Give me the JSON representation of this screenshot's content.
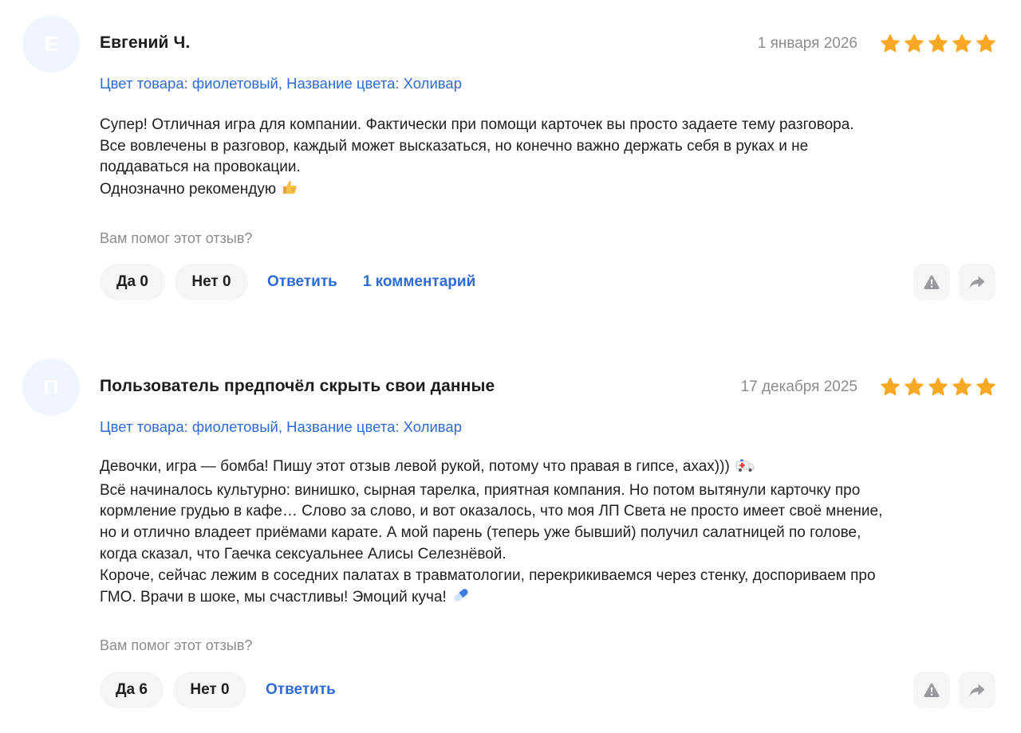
{
  "colors": {
    "star": "#f9a825",
    "link": "#2f6bd6",
    "muted": "#8c8c8c",
    "pill_bg": "#f5f5f7",
    "avatar_bg": "#f0f5fd"
  },
  "reviews": [
    {
      "avatar_letter": "Е",
      "author": "Евгений Ч.",
      "date": "1 января 2026",
      "rating": 5,
      "variant": "Цвет товара: фиолетовый, Название цвета: Холивар",
      "text_lines": [
        "Супер! Отличная игра для компании. Фактически при помощи карточек вы просто задаете тему разговора.",
        "Все вовлечены в разговор, каждый может высказаться, но конечно важно держать себя в руках и не",
        "поддаваться на провокации.",
        "Однозначно рекомендую"
      ],
      "emoji_icon": "thumbs-up-emoji",
      "helpful_question": "Вам помог этот отзыв?",
      "yes_label": "Да 0",
      "no_label": "Нет 0",
      "reply_label": "Ответить",
      "comments_label": "1 комментарий",
      "report_icon": "warning-icon",
      "share_icon": "share-icon"
    },
    {
      "avatar_letter": "П",
      "author": "Пользователь предпочёл скрыть свои данные",
      "date": "17 декабря 2025",
      "rating": 5,
      "variant": "Цвет товара: фиолетовый, Название цвета: Холивар",
      "text_lines": [
        "Девочки, игра — бомба! Пишу этот отзыв левой рукой, потому что правая в гипсе, ахах)))",
        "Всё начиналось культурно: винишко, сырная тарелка, приятная компания. Но потом вытянули карточку про",
        "кормление грудью в кафе… Слово за слово, и вот оказалось, что моя ЛП Света не просто имеет своё мнение,",
        "но и отлично владеет приёмами карате. А мой парень (теперь уже бывший) получил салатницей по голове,",
        "когда сказал, что Гаечка сексуальнее Алисы Селезнёвой.",
        "Короче, сейчас лежим в соседних палатах в травматологии, перекрикиваемся через стенку, доспориваем про",
        "ГМО. Врачи в шоке, мы счастливы! Эмоций куча!"
      ],
      "emoji_icon_line1": "ambulance-emoji",
      "emoji_icon_last": "pill-emoji",
      "helpful_question": "Вам помог этот отзыв?",
      "yes_label": "Да 6",
      "no_label": "Нет 0",
      "reply_label": "Ответить",
      "report_icon": "warning-icon",
      "share_icon": "share-icon"
    }
  ]
}
